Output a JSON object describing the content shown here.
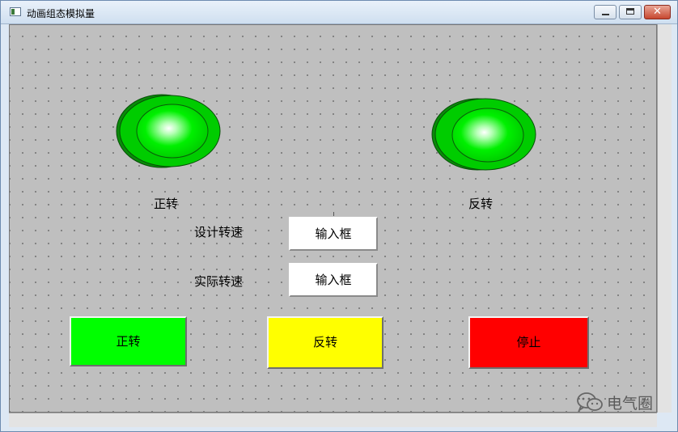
{
  "window": {
    "title": "动画组态模拟量",
    "controls": {
      "minimize": "minimize-icon",
      "maximize": "maximize-icon",
      "close": "close-icon",
      "close_glyph": "✕"
    }
  },
  "lamps": [
    {
      "label": "正转",
      "color": "#00e400"
    },
    {
      "label": "反转",
      "color": "#00e400"
    }
  ],
  "fields": [
    {
      "label": "设计转速",
      "value": "输入框"
    },
    {
      "label": "实际转速",
      "value": "输入框"
    }
  ],
  "buttons": [
    {
      "label": "正转",
      "color": "#00ff00"
    },
    {
      "label": "反转",
      "color": "#ffff00"
    },
    {
      "label": "停止",
      "color": "#ff0000"
    }
  ],
  "watermark": {
    "text": "电气圈",
    "icon": "wechat-icon"
  }
}
